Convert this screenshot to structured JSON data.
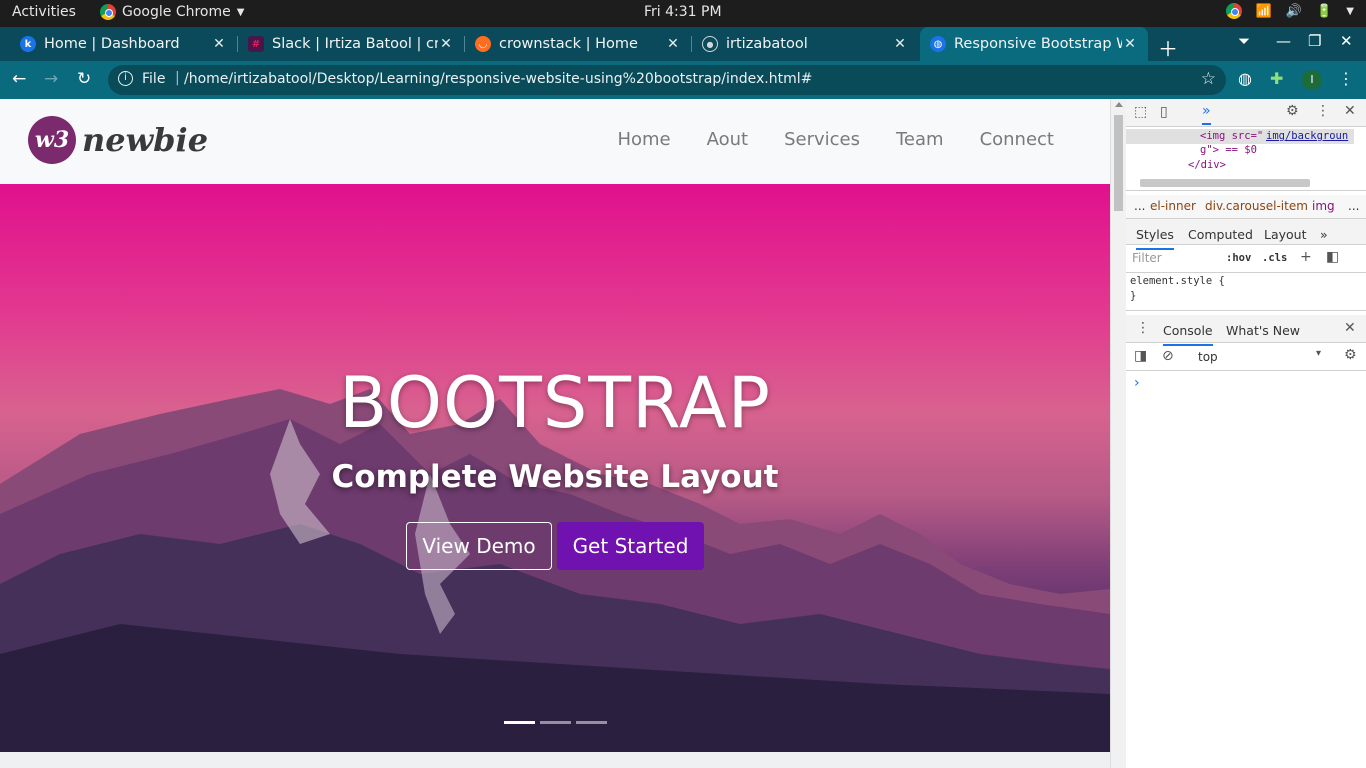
{
  "os_bar": {
    "activities": "Activities",
    "app_name": "Google Chrome",
    "clock": "Fri  4:31 PM"
  },
  "tabs": [
    {
      "title": "Home | Dashboard",
      "favicon_color": "#1a73e8",
      "favicon_letter": "k"
    },
    {
      "title": "Slack | Irtiza Batool | cro",
      "favicon_color": "#4a154b",
      "favicon_letter": "#"
    },
    {
      "title": "crownstack | Home",
      "favicon_color": "#ff6d1f",
      "favicon_letter": "◡"
    },
    {
      "title": "irtizabatool",
      "favicon_color": "#0d1117",
      "favicon_letter": "●"
    },
    {
      "title": "Responsive Bootstrap W",
      "favicon_color": "#1a73e8",
      "favicon_letter": "◍"
    }
  ],
  "address_bar": {
    "scheme": "File",
    "url": "/home/irtizabatool/Desktop/Learning/responsive-website-using%20bootstrap/index.html#",
    "profile_initial": "I"
  },
  "site": {
    "logo_mark": "w3",
    "logo_word": "newbie",
    "menu": [
      "Home",
      "Aout",
      "Services",
      "Team",
      "Connect"
    ],
    "hero_title": "BOOTSTRAP",
    "hero_subtitle": "Complete Website Layout",
    "btn_demo": "View Demo",
    "btn_start": "Get Started",
    "carousel_active": 0,
    "carousel_count": 3
  },
  "devtools": {
    "dom_line1_tag": "<img src=\"",
    "dom_line1_link": "img/backgroun",
    "dom_line2": "g\"> == $0",
    "dom_line3": "</div>",
    "crumbs": [
      "...",
      "el-inner",
      "div.carousel-item",
      "img",
      "..."
    ],
    "tabs": [
      "Styles",
      "Computed",
      "Layout",
      "»"
    ],
    "filter_placeholder": "Filter",
    "hov": ":hov",
    "cls": ".cls",
    "element_style": "element.style {",
    "close_brace": "}",
    "drawer_tabs": [
      "Console",
      "What's New"
    ],
    "context": "top",
    "prompt": "›"
  }
}
